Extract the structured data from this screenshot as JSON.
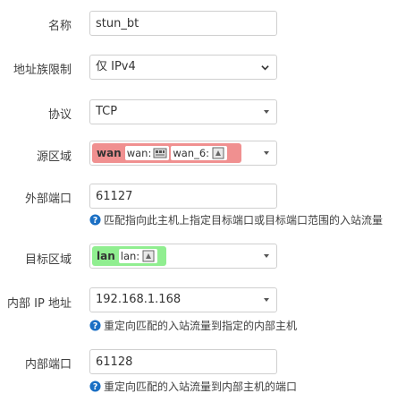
{
  "fields": {
    "name": {
      "label": "名称",
      "value": "stun_bt"
    },
    "family": {
      "label": "地址族限制",
      "value": "仅 IPv4"
    },
    "protocol": {
      "label": "协议",
      "value": "TCP"
    },
    "src_zone": {
      "label": "源区域",
      "zone_name": "wan",
      "chips": [
        "wan:",
        "wan_6:"
      ],
      "color": "#f09090"
    },
    "ext_port": {
      "label": "外部端口",
      "value": "61127",
      "hint": "匹配指向此主机上指定目标端口或目标端口范围的入站流量"
    },
    "dest_zone": {
      "label": "目标区域",
      "zone_name": "lan",
      "chips": [
        "lan:"
      ],
      "color": "#90ee90"
    },
    "int_ip": {
      "label": "内部 IP 地址",
      "value": "192.168.1.168",
      "hint": "重定向匹配的入站流量到指定的内部主机"
    },
    "int_port": {
      "label": "内部端口",
      "value": "61128",
      "hint": "重定向匹配的入站流量到内部主机的端口"
    }
  },
  "colors": {
    "help_icon": "#1a6fc4",
    "border": "#cfcfcf"
  }
}
